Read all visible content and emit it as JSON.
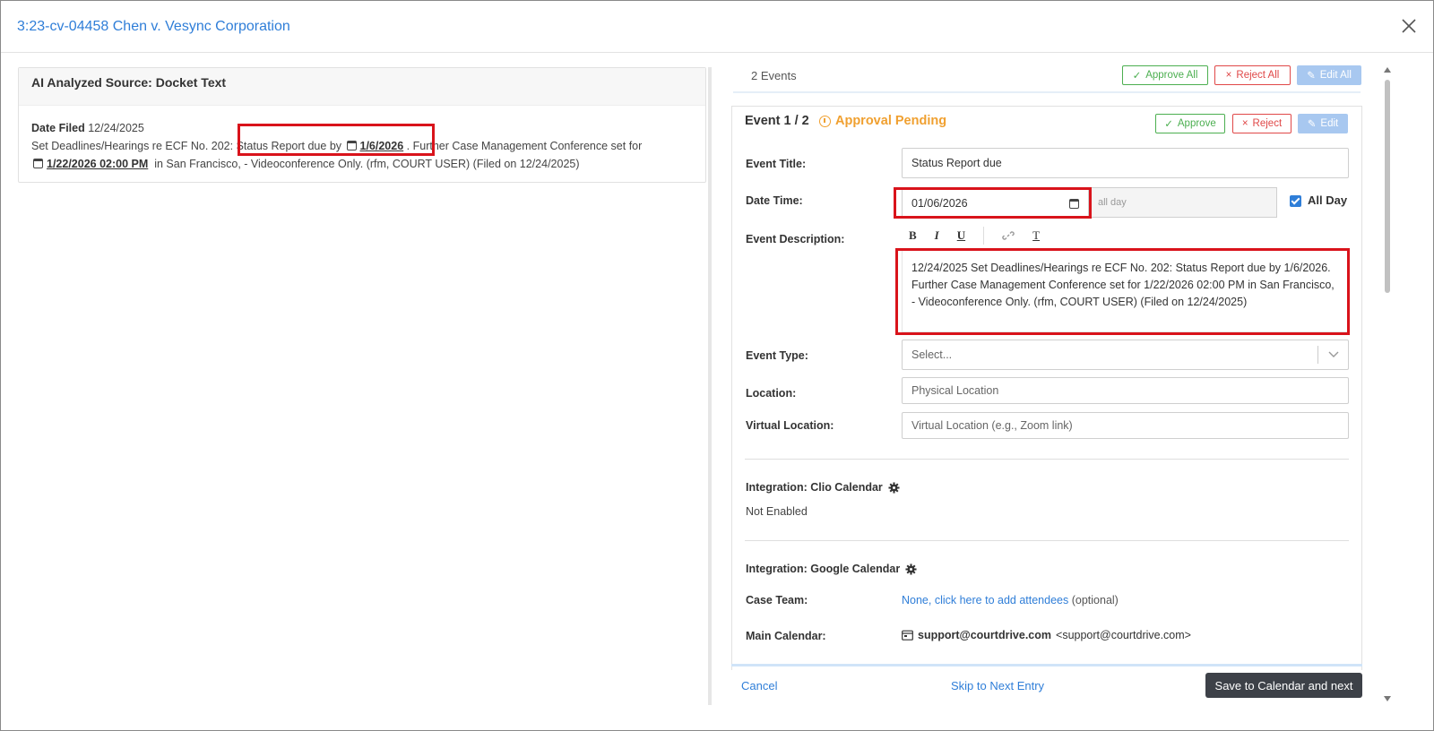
{
  "dialog": {
    "title": "3:23-cv-04458 Chen v. Vesync Corporation"
  },
  "source": {
    "heading": "AI Analyzed Source: Docket Text",
    "date_filed_label": "Date Filed",
    "date_filed": "12/24/2025",
    "text_part1": "Set Deadlines/Hearings re ECF No. 202: Status Report due by",
    "date1": "1/6/2026",
    "text_part2": ". Further Case Management Conference set for",
    "date2": "1/22/2026 02:00 PM",
    "text_part3": "in San Francisco, - Videoconference Only. (rfm, COURT USER) (Filed on 12/24/2025)"
  },
  "events_header": {
    "count_label": "2 Events",
    "approve_all": "Approve All",
    "reject_all": "Reject All",
    "edit_all": "Edit All"
  },
  "event": {
    "counter": "Event 1 / 2",
    "status": "Approval Pending",
    "approve": "Approve",
    "reject": "Reject",
    "edit": "Edit",
    "title_label": "Event Title:",
    "title_value": "Status Report due",
    "datetime_label": "Date Time:",
    "date_value": "01/06/2026",
    "time_placeholder": "all day",
    "all_day_label": "All Day",
    "all_day_checked": true,
    "description_label": "Event Description:",
    "toolbar": {
      "bold": "B",
      "italic": "I",
      "underline": "U",
      "clear": "T"
    },
    "description_value": "12/24/2025 Set Deadlines/Hearings re ECF No. 202: Status Report due by 1/6/2026. Further Case Management Conference set for 1/22/2026 02:00 PM in San Francisco, - Videoconference Only. (rfm, COURT USER) (Filed on 12/24/2025)",
    "type_label": "Event Type:",
    "type_placeholder": "Select...",
    "location_label": "Location:",
    "location_placeholder": "Physical Location",
    "virtual_label": "Virtual Location:",
    "virtual_placeholder": "Virtual Location (e.g., Zoom link)",
    "clio_label": "Integration: Clio Calendar",
    "clio_status": "Not Enabled",
    "google_label": "Integration: Google Calendar",
    "team_label": "Case Team:",
    "team_link": "None, click here to add attendees",
    "team_optional": "(optional)",
    "main_cal_label": "Main Calendar:",
    "main_cal_name": "support@courtdrive.com",
    "main_cal_email": "<support@courtdrive.com>"
  },
  "footer": {
    "cancel": "Cancel",
    "skip": "Skip to Next Entry",
    "save": "Save to Calendar and next"
  },
  "colors": {
    "link": "#2f7ed8",
    "approve": "#4caf50",
    "reject": "#e04848",
    "pending": "#f0a030",
    "highlight": "#d9131b",
    "primary_dark": "#3d4148"
  }
}
